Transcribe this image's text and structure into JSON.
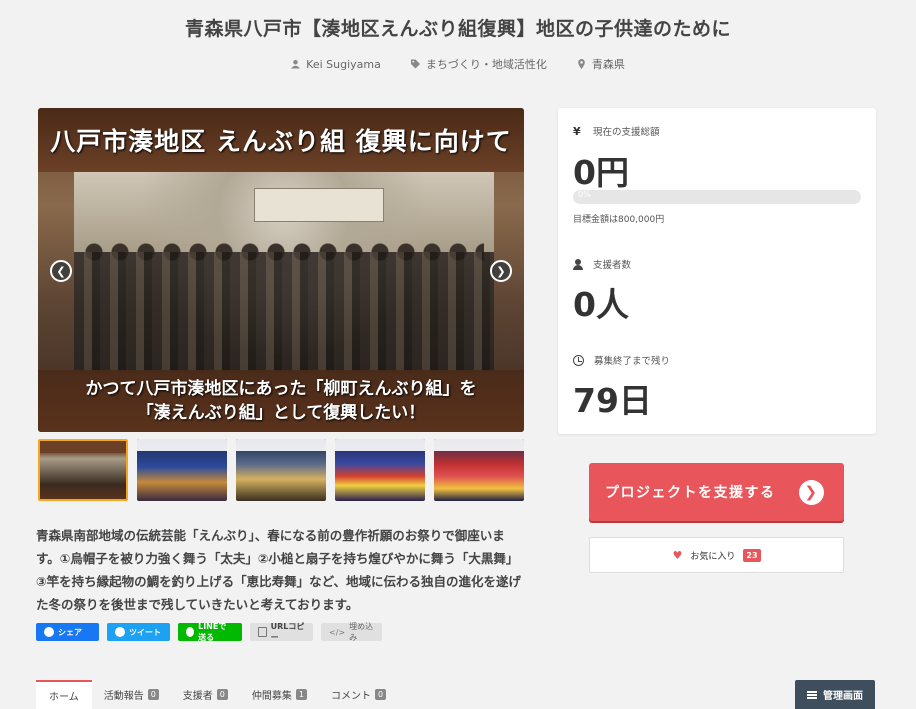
{
  "page": {
    "title": "青森県八戸市【湊地区えんぶり組復興】地区の子供達のために",
    "author": "Kei Sugiyama",
    "category": "まちづくり・地域活性化",
    "location": "青森県"
  },
  "hero": {
    "banner_top": "八戸市湊地区 えんぶり組 復興に向けて",
    "banner_bottom_line1": "かつて八戸市湊地区にあった「柳町えんぶり組」を",
    "banner_bottom_line2": "「湊えんぶり組」として復興したい！",
    "prev_icon": "chevron-left-icon",
    "next_icon": "chevron-right-icon"
  },
  "thumbnails": [
    "thumb-1",
    "thumb-2",
    "thumb-3",
    "thumb-4",
    "thumb-5"
  ],
  "description": "青森県南部地域の伝統芸能「えんぶり」、春になる前の豊作祈願のお祭りで御座います。①烏帽子を被り力強く舞う「太夫」②小槌と扇子を持ち煌びやかに舞う「大黒舞」③竿を持ち縁起物の鯛を釣り上げる「恵比寿舞」など、地域に伝わる独自の進化を遂げた冬の祭りを後世まで残していきたいと考えております。",
  "share": {
    "facebook": "シェア",
    "twitter": "ツイート",
    "line": "LINEで送る",
    "url": "URLコピー",
    "embed": "埋め込み"
  },
  "stats": {
    "total_label": "現在の支援総額",
    "total_value": "0円",
    "progress_percent": 0,
    "progress_text": "0%",
    "goal_text": "目標金額は800,000円",
    "supporters_label": "支援者数",
    "supporters_value": "0人",
    "remaining_label": "募集終了まで残り",
    "remaining_value": "79日"
  },
  "actions": {
    "support_label": "プロジェクトを支援する",
    "favorite_label": "お気に入り",
    "favorite_count": "23"
  },
  "tabs": [
    {
      "label": "ホーム",
      "badge": null
    },
    {
      "label": "活動報告",
      "badge": "0"
    },
    {
      "label": "支援者",
      "badge": "0"
    },
    {
      "label": "仲間募集",
      "badge": "1"
    },
    {
      "label": "コメント",
      "badge": "0"
    }
  ],
  "admin": {
    "label": "管理画面"
  },
  "colors": {
    "accent": "#e8565c",
    "admin": "#3f4e5c",
    "facebook": "#1877f2",
    "twitter": "#1da1f2",
    "line": "#00b900"
  }
}
